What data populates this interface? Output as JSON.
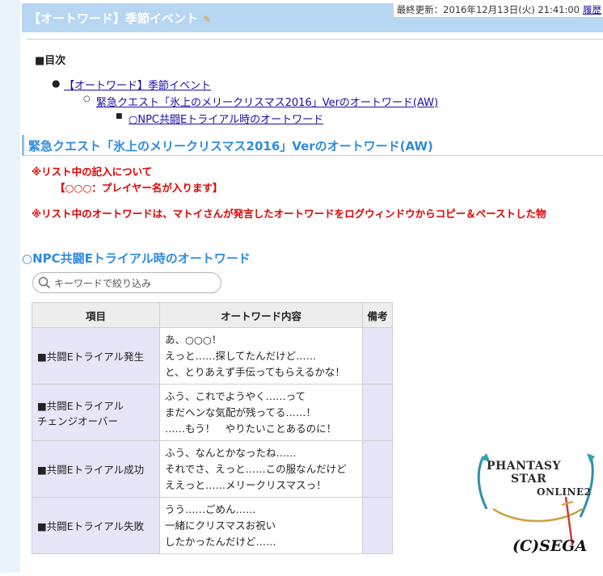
{
  "header": {
    "page_title": "【オートワード】季節イベント",
    "edit_icon": "pencil-icon",
    "last_updated": "最終更新：2016年12月13日(火) 21:41:00",
    "history_link": "履歴"
  },
  "toc": {
    "title": "■目次",
    "items": [
      {
        "label": "【オートワード】季節イベント",
        "level": 1
      },
      {
        "label": "緊急クエスト「氷上のメリークリスマス2016」Verのオートワード(AW)",
        "level": 2
      },
      {
        "label": "○NPC共闘Eトライアル時のオートワード",
        "level": 3
      }
    ]
  },
  "section": {
    "heading": "緊急クエスト「氷上のメリークリスマス2016」Verのオートワード(AW)",
    "notes": [
      "※リスト中の記入について",
      "【○○○：プレイヤー名が入ります】",
      "※リスト中のオートワードは、マトイさんが発言したオートワードをログウィンドウからコピー＆ペーストした物"
    ]
  },
  "subsection": {
    "heading": "○NPC共闘Eトライアル時のオートワード",
    "search_placeholder": "キーワードで絞り込み",
    "search_value": "",
    "table": {
      "headers": [
        "項目",
        "オートワード内容",
        "備考"
      ],
      "rows": [
        {
          "item": [
            "■共闘Eトライアル発生"
          ],
          "content": [
            "あ、○○○！",
            "えっと……探してたんだけど……",
            "と、とりあえず手伝ってもらえるかな！"
          ],
          "remarks": ""
        },
        {
          "item": [
            "■共闘Eトライアル",
            "チェンジオーバー"
          ],
          "content": [
            "ふう、これでようやく……って",
            "まだヘンな気配が残ってる……！",
            "……もう！　やりたいことあるのに！"
          ],
          "remarks": ""
        },
        {
          "item": [
            "■共闘Eトライアル成功"
          ],
          "content": [
            "ふう、なんとかなったね……",
            "それでさ、えっと……この服なんだけど",
            "ええっと……メリークリスマスっ！"
          ],
          "remarks": ""
        },
        {
          "item": [
            "■共闘Eトライアル失敗"
          ],
          "content": [
            "うう……ごめん……",
            "一緒にクリスマスお祝い",
            "したかったんだけど……"
          ],
          "remarks": ""
        }
      ]
    }
  },
  "logo": {
    "title_lines": [
      "PHANTASY",
      "STAR",
      "ONLINE2"
    ],
    "copyright": "(C)SEGA"
  },
  "colors": {
    "title_bar": "#b7d6f2",
    "heading_blue": "#2e8be0",
    "note_red": "#e00000",
    "link": "#1a0dab",
    "table_cell_purple": "#e7e6f8",
    "table_header": "#ededed"
  }
}
